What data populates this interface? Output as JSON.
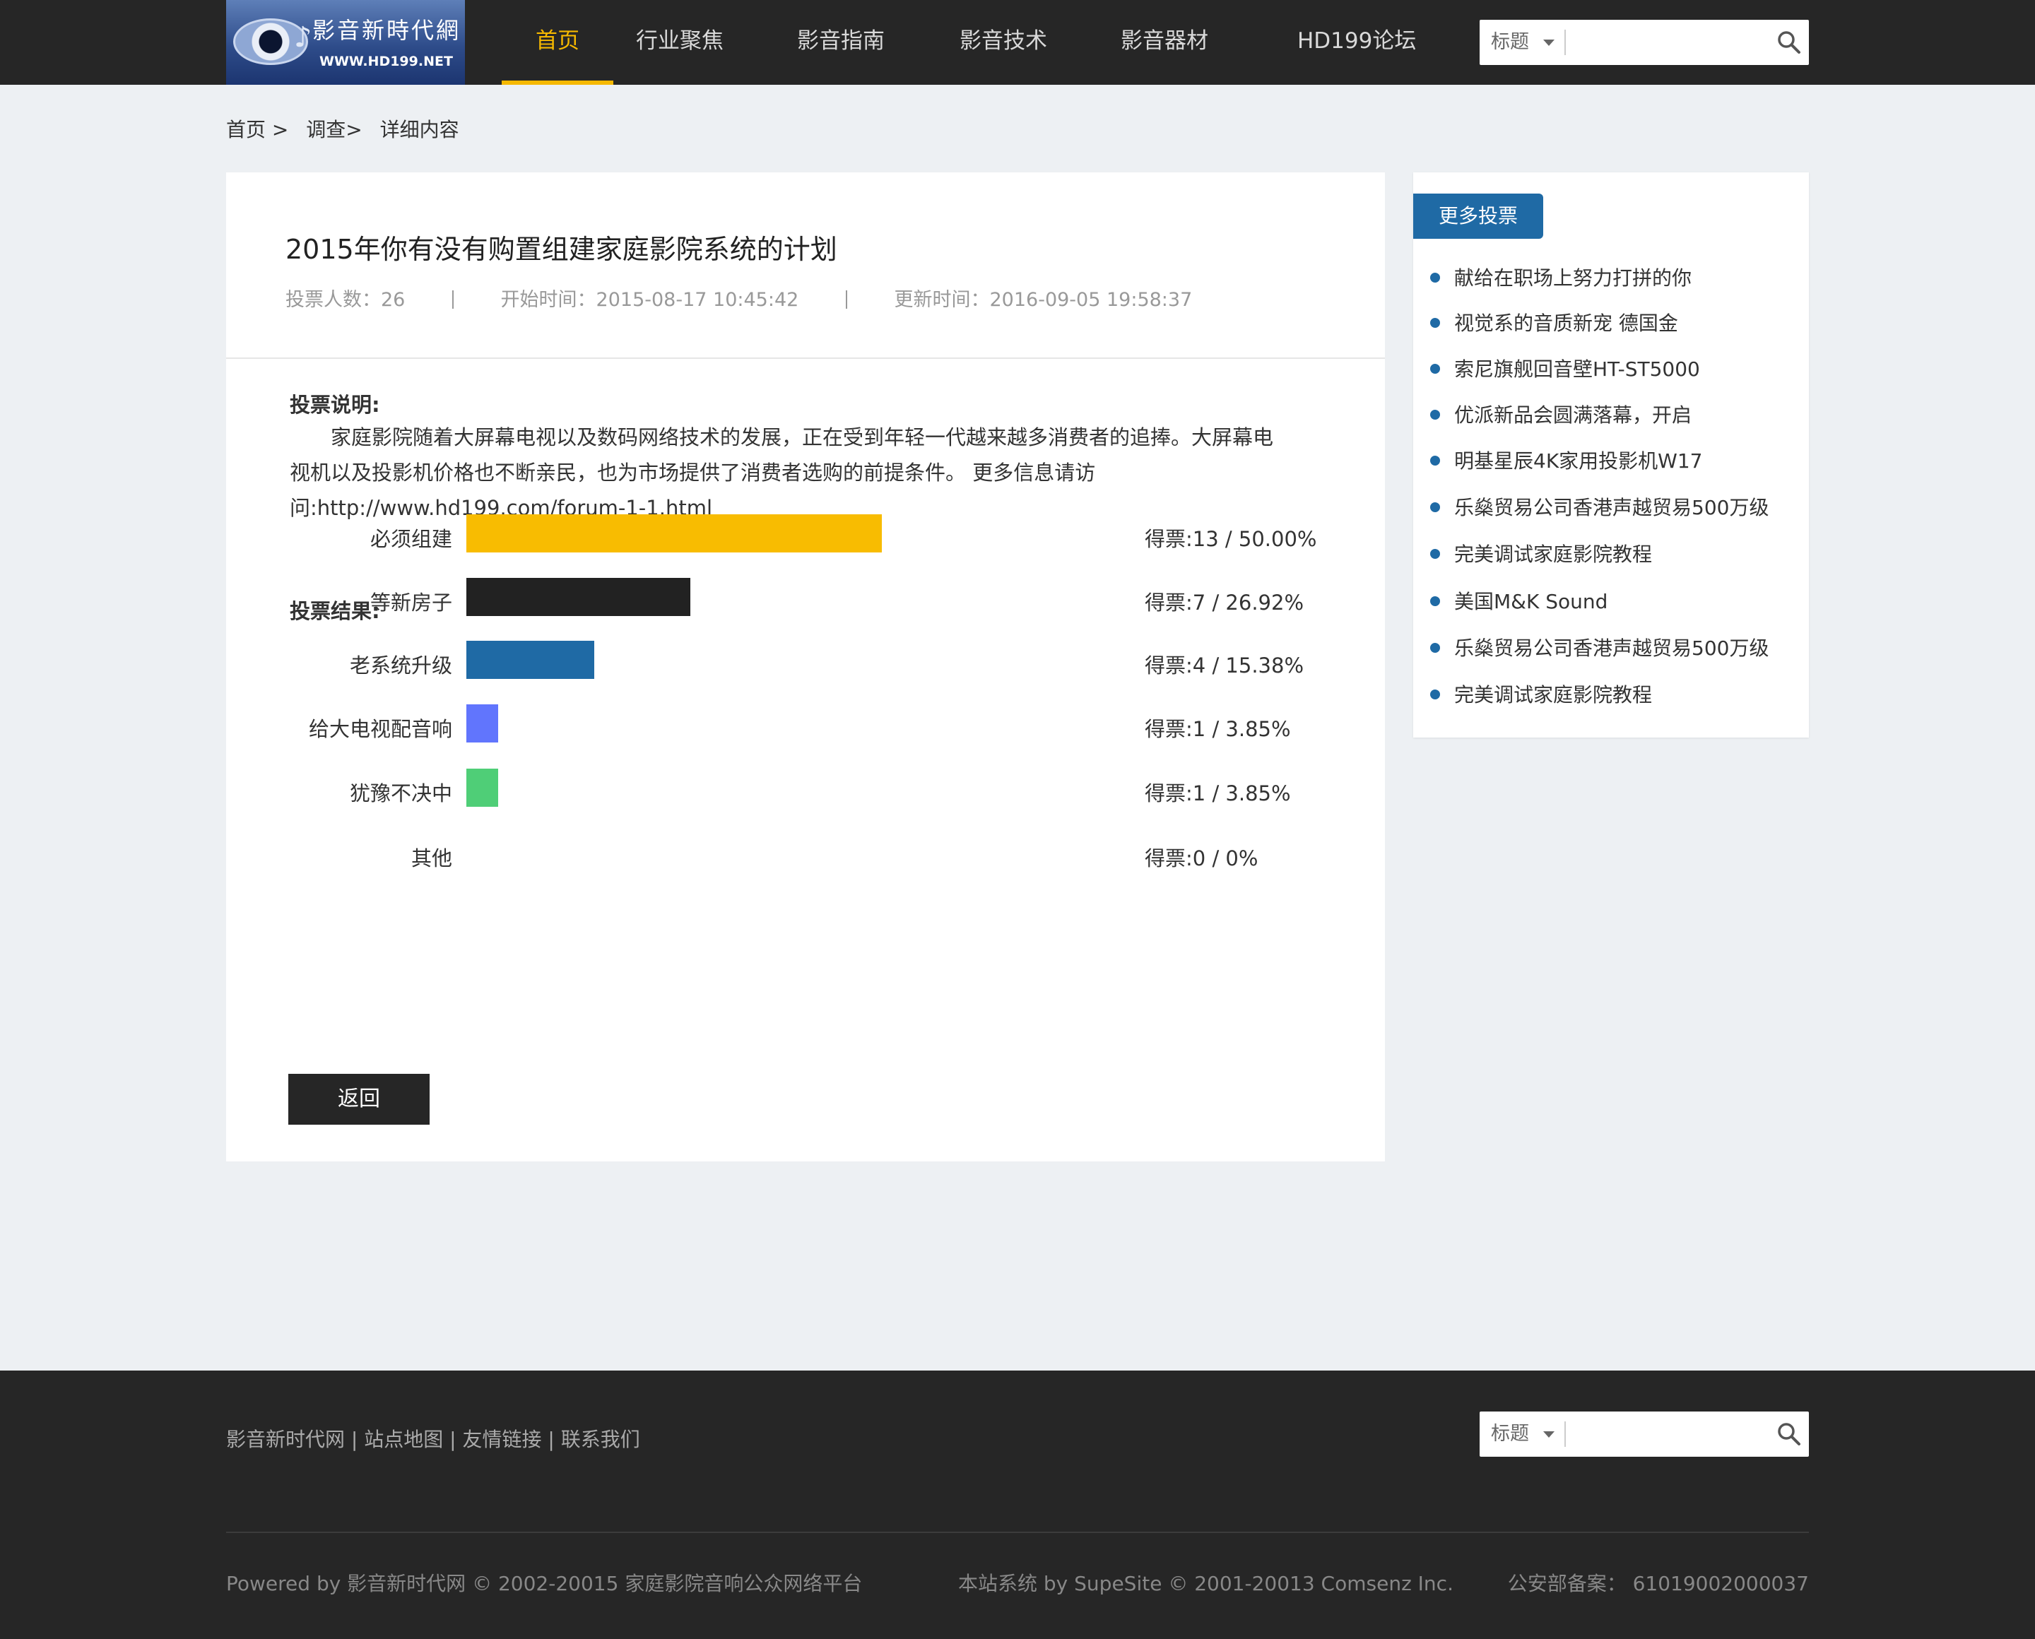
{
  "logo": {
    "name": "影音新時代網",
    "url": "WWW.HD199.NET"
  },
  "nav": [
    "首页",
    "行业聚焦",
    "影音指南",
    "影音技术",
    "影音器材",
    "HD199论坛"
  ],
  "search": {
    "select_label": "标题",
    "placeholder": ""
  },
  "breadcrumb": [
    "首页 >",
    "调查>",
    "详细内容"
  ],
  "poll": {
    "title": "2015年你有没有购置组建家庭影院系统的计划",
    "meta": {
      "voters": "投票人数：26",
      "start": "开始时间：2015-08-17 10:45:42",
      "updated": "更新时间：2016-09-05 19:58:37"
    },
    "desc_heading": "投票说明:",
    "description": "家庭影院随着大屏幕电视以及数码网络技术的发展，正在受到年轻一代越来越多消费者的追捧。大屏幕电视机以及投影机价格也不断亲民，也为市场提供了消费者选购的前提条件。 更多信息请访问:http://www.hd199.com/forum-1-1.html",
    "results_heading": "投票结果:",
    "options": [
      {
        "label": "必须组建",
        "votes": "得票:13 / 50.00%",
        "percent": 50.0,
        "color": "#f8bc01"
      },
      {
        "label": "等新房子",
        "votes": "得票:7 / 26.92%",
        "percent": 26.92,
        "color": "#222222"
      },
      {
        "label": "老系统升级",
        "votes": "得票:4 / 15.38%",
        "percent": 15.38,
        "color": "#1f6aa5"
      },
      {
        "label": "给大电视配音响",
        "votes": "得票:1 / 3.85%",
        "percent": 3.85,
        "color": "#6175fd"
      },
      {
        "label": "犹豫不决中",
        "votes": "得票:1 / 3.85%",
        "percent": 3.85,
        "color": "#4fce77"
      },
      {
        "label": "其他",
        "votes": "得票:0 / 0%",
        "percent": 0,
        "color": "#cccccc"
      }
    ],
    "back_label": "返回"
  },
  "sidebar": {
    "heading": "更多投票",
    "items": [
      "献给在职场上努力打拼的你",
      "视觉系的音质新宠 德国金",
      "索尼旗舰回音壁HT-ST5000",
      "优派新品会圆满落幕，开启",
      "明基星辰4K家用投影机W17",
      "乐燊贸易公司香港声越贸易500万级",
      "完美调试家庭影院教程",
      "美国M&K Sound",
      "乐燊贸易公司香港声越贸易500万级",
      "完美调试家庭影院教程"
    ]
  },
  "footer": {
    "links": "影音新时代网 | 站点地图 | 友情链接 | 联系我们",
    "powered": "Powered by 影音新时代网 © 2002-20015 家庭影院音响公众网络平台",
    "system": "本站系统 by SupeSite © 2001-20013 Comsenz Inc.",
    "icp": "公安部备案： 61019002000037"
  }
}
